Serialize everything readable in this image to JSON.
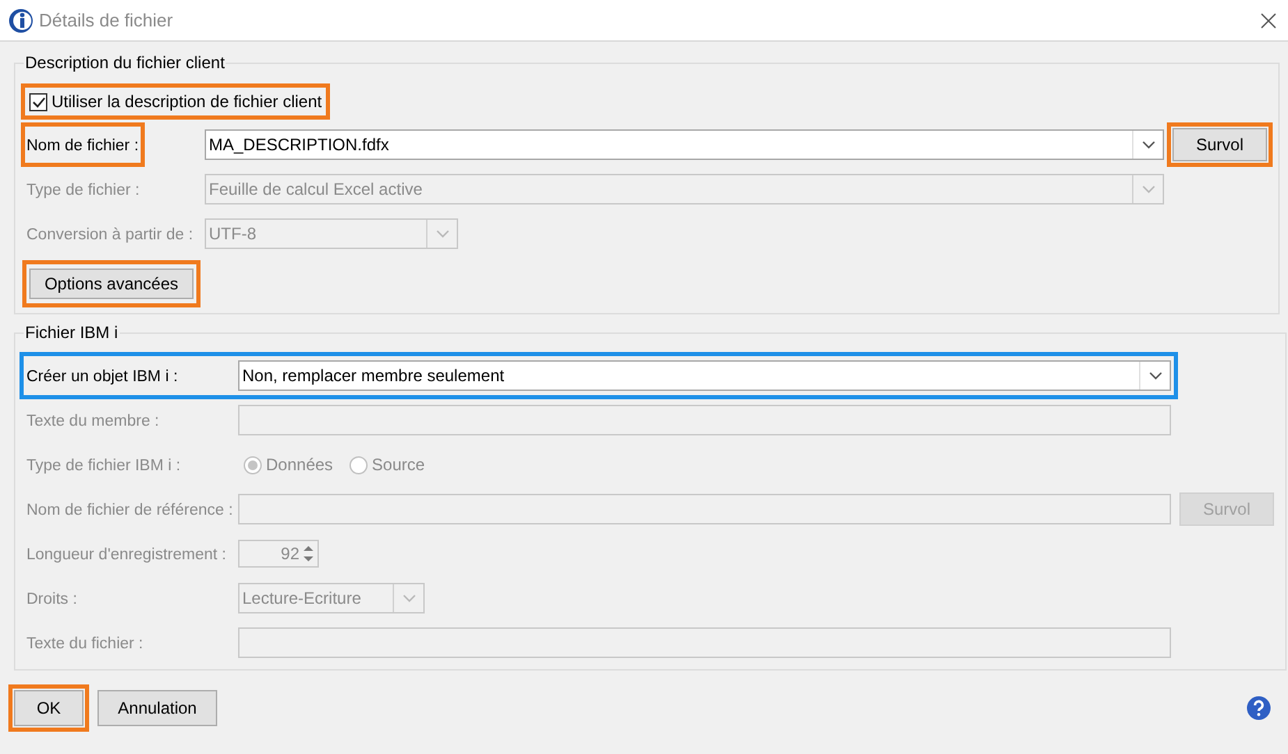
{
  "window": {
    "title": "Détails de fichier"
  },
  "client_group": {
    "title": "Description du fichier client",
    "use_description": {
      "label": "Utiliser la description de fichier client",
      "checked": true,
      "highlight": {
        "color": "#f07a1e"
      }
    },
    "rows": [
      {
        "kind": "combo",
        "label": "Nom de fichier :",
        "value": "MA_DESCRIPTION.fdfx",
        "disabled": false,
        "label_highlight": {
          "color": "#f07a1e"
        },
        "button": {
          "label": "Survol",
          "disabled": false,
          "highlight": {
            "color": "#f07a1e"
          }
        }
      },
      {
        "kind": "combo",
        "label": "Type de fichier :",
        "value": "Feuille de calcul Excel active",
        "disabled": true
      },
      {
        "kind": "short-combo",
        "label": "Conversion à partir de :",
        "value": "UTF-8",
        "disabled": true
      }
    ],
    "advanced_button": {
      "label": "Options avancées",
      "highlight": {
        "color": "#f07a1e"
      }
    }
  },
  "ibm_group": {
    "title": "Fichier IBM i",
    "rows": [
      {
        "kind": "combo",
        "label": "Créer un objet IBM i :",
        "value": "Non, remplacer membre seulement",
        "disabled": false,
        "row_highlight": {
          "color": "#1e90e8"
        }
      },
      {
        "kind": "text",
        "label": "Texte du membre :",
        "disabled": true
      },
      {
        "kind": "radio",
        "label": "Type de fichier IBM i :",
        "disabled": true,
        "options": [
          {
            "label": "Données",
            "selected": true
          },
          {
            "label": "Source",
            "selected": false
          }
        ]
      },
      {
        "kind": "text",
        "label": "Nom de fichier de référence :",
        "disabled": true,
        "button": {
          "label": "Survol",
          "disabled": true
        }
      },
      {
        "kind": "spinner",
        "label": "Longueur d'enregistrement :",
        "value": "92",
        "disabled": true
      },
      {
        "kind": "short-combo",
        "label": "Droits :",
        "value": "Lecture-Ecriture",
        "disabled": true
      },
      {
        "kind": "text",
        "label": "Texte du fichier :",
        "disabled": true
      }
    ]
  },
  "buttons": [
    {
      "label": "OK",
      "highlight": {
        "color": "#f07a1e"
      }
    },
    {
      "label": "Annulation"
    }
  ]
}
